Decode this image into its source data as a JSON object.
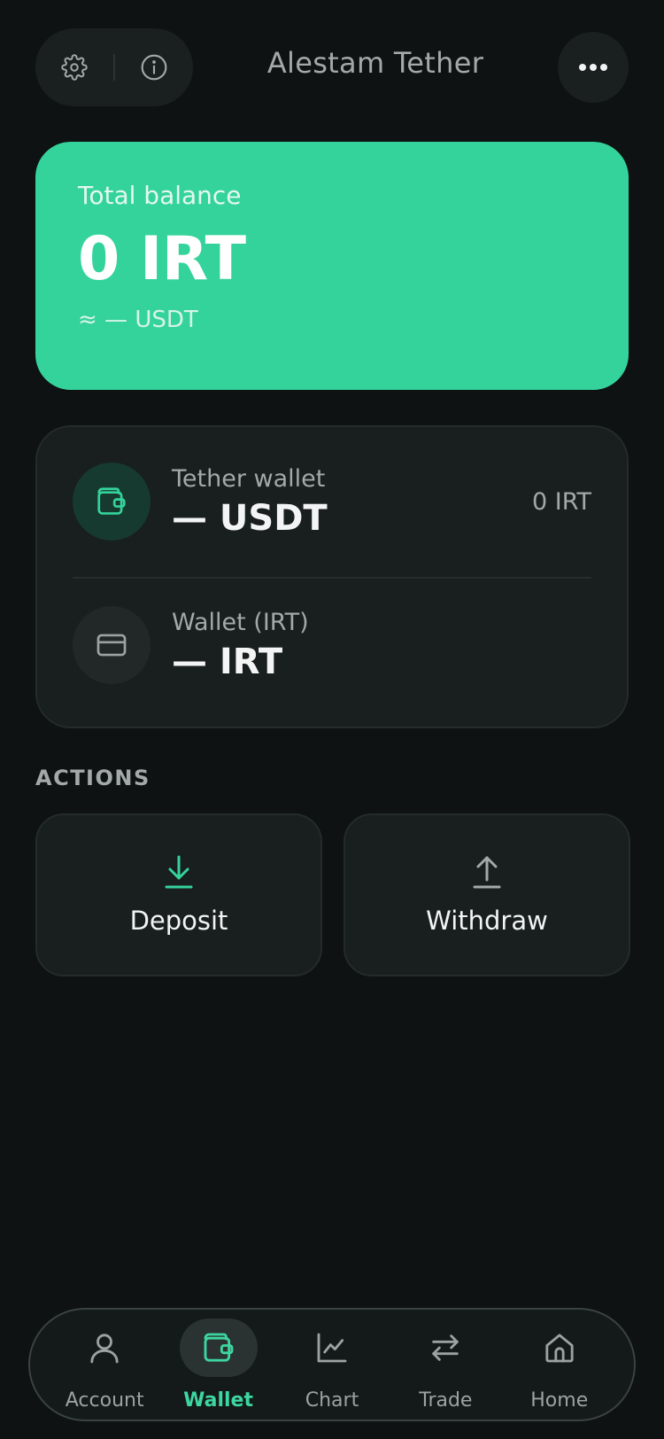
{
  "header": {
    "title": "Alestam Tether",
    "settings_icon": "gear-icon",
    "info_icon": "info-icon",
    "more_icon": "more-horizontal-icon"
  },
  "balance": {
    "label": "Total balance",
    "amount": "0 IRT",
    "approx": "≈ — USDT"
  },
  "wallets": [
    {
      "name": "Tether wallet",
      "amount": "— USDT",
      "value": "0 IRT",
      "icon": "wallet-icon"
    },
    {
      "name": "Wallet (IRT)",
      "amount": "— IRT",
      "value": "",
      "icon": "card-icon"
    }
  ],
  "actions": {
    "title": "ACTIONS",
    "deposit": {
      "label": "Deposit",
      "icon": "download-icon"
    },
    "withdraw": {
      "label": "Withdraw",
      "icon": "upload-icon"
    }
  },
  "nav": {
    "items": [
      {
        "label": "Account",
        "icon": "user-icon"
      },
      {
        "label": "Wallet",
        "icon": "wallet-icon",
        "active": true
      },
      {
        "label": "Chart",
        "icon": "chart-icon"
      },
      {
        "label": "Trade",
        "icon": "swap-icon"
      },
      {
        "label": "Home",
        "icon": "home-icon"
      }
    ]
  },
  "colors": {
    "background": "#0e1212",
    "accent": "#35d39c",
    "card": "#191e1e",
    "muted_text": "#a3a9a9"
  }
}
